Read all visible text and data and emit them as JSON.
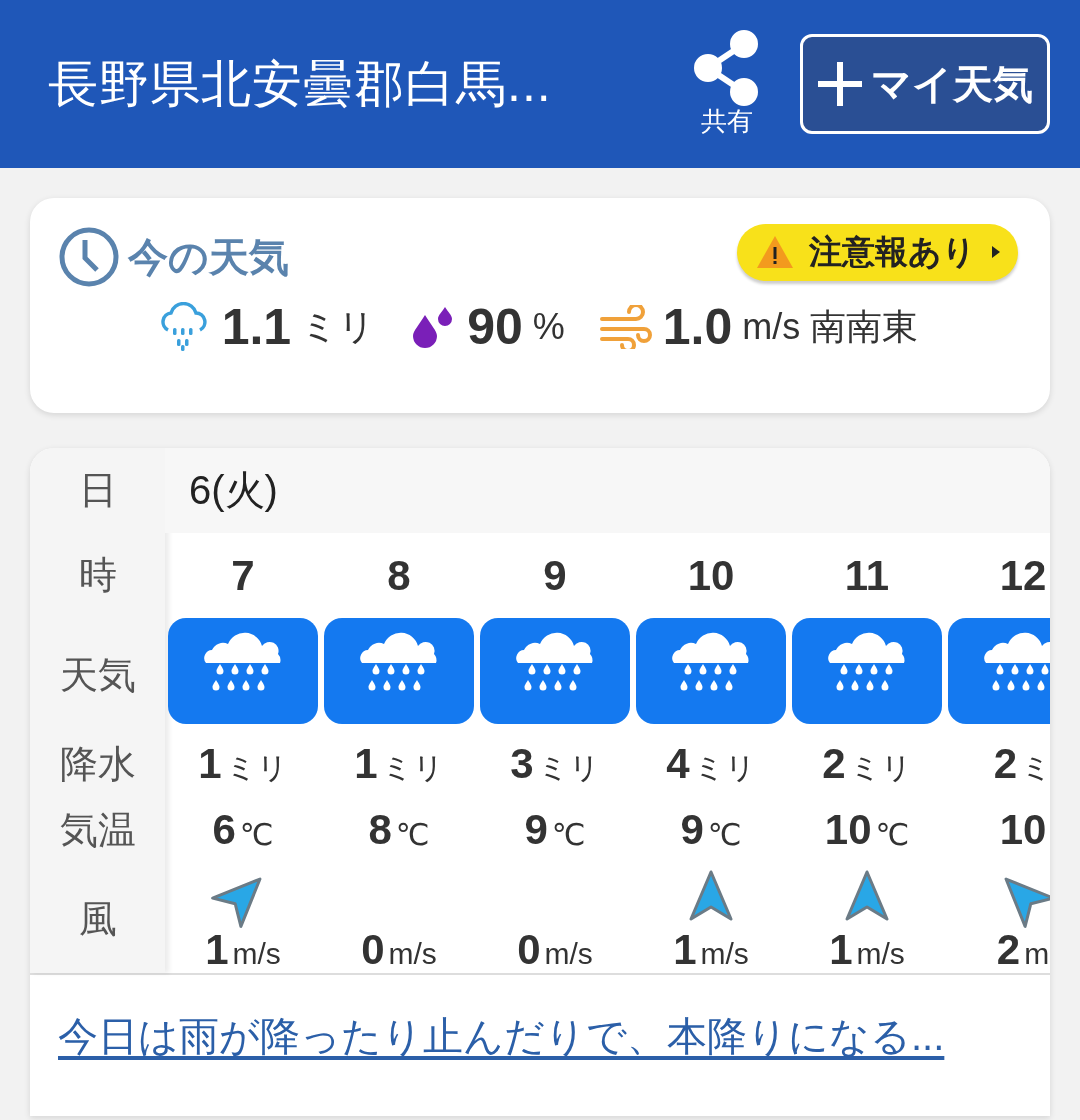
{
  "header": {
    "title": "長野県北安曇郡白馬...",
    "share_label": "共有",
    "my_weather_button": "マイ天気"
  },
  "now": {
    "title": "今の天気",
    "alert": "注意報あり",
    "precip": {
      "value": "1.1",
      "unit": "ミリ"
    },
    "humidity": {
      "value": "90",
      "unit": "%"
    },
    "wind": {
      "value": "1.0",
      "unit": "m/s",
      "direction": "南南東"
    }
  },
  "forecast": {
    "row_labels": [
      "日",
      "時",
      "天気",
      "降水",
      "気温",
      "風"
    ],
    "date": "6(火)",
    "hours": [
      {
        "hour": "7",
        "kind": "rain",
        "precip": "1",
        "precip_unit": "ミリ",
        "temp": "6",
        "temp_unit": "℃",
        "wind_arrow": {
          "kind": "northeast"
        },
        "wind": "1",
        "wind_unit": "m/s"
      },
      {
        "hour": "8",
        "kind": "rain",
        "precip": "1",
        "precip_unit": "ミリ",
        "temp": "8",
        "temp_unit": "℃",
        "wind": "0",
        "wind_unit": "m/s"
      },
      {
        "hour": "9",
        "kind": "rain",
        "precip": "3",
        "precip_unit": "ミリ",
        "temp": "9",
        "temp_unit": "℃",
        "wind": "0",
        "wind_unit": "m/s"
      },
      {
        "hour": "10",
        "kind": "rain",
        "precip": "4",
        "precip_unit": "ミリ",
        "temp": "9",
        "temp_unit": "℃",
        "wind_arrow": {
          "kind": "north"
        },
        "wind": "1",
        "wind_unit": "m/s"
      },
      {
        "hour": "11",
        "kind": "rain",
        "precip": "2",
        "precip_unit": "ミリ",
        "temp": "10",
        "temp_unit": "℃",
        "wind_arrow": {
          "kind": "north"
        },
        "wind": "1",
        "wind_unit": "m/s"
      },
      {
        "hour": "12",
        "kind": "rain",
        "precip": "2",
        "precip_unit": "ミ",
        "temp": "10",
        "wind_arrow": {
          "kind": "northwest"
        },
        "wind": "2",
        "wind_unit": "m"
      }
    ]
  },
  "summary_link": "今日は雨が降ったり止んだりで、本降りになる..."
}
